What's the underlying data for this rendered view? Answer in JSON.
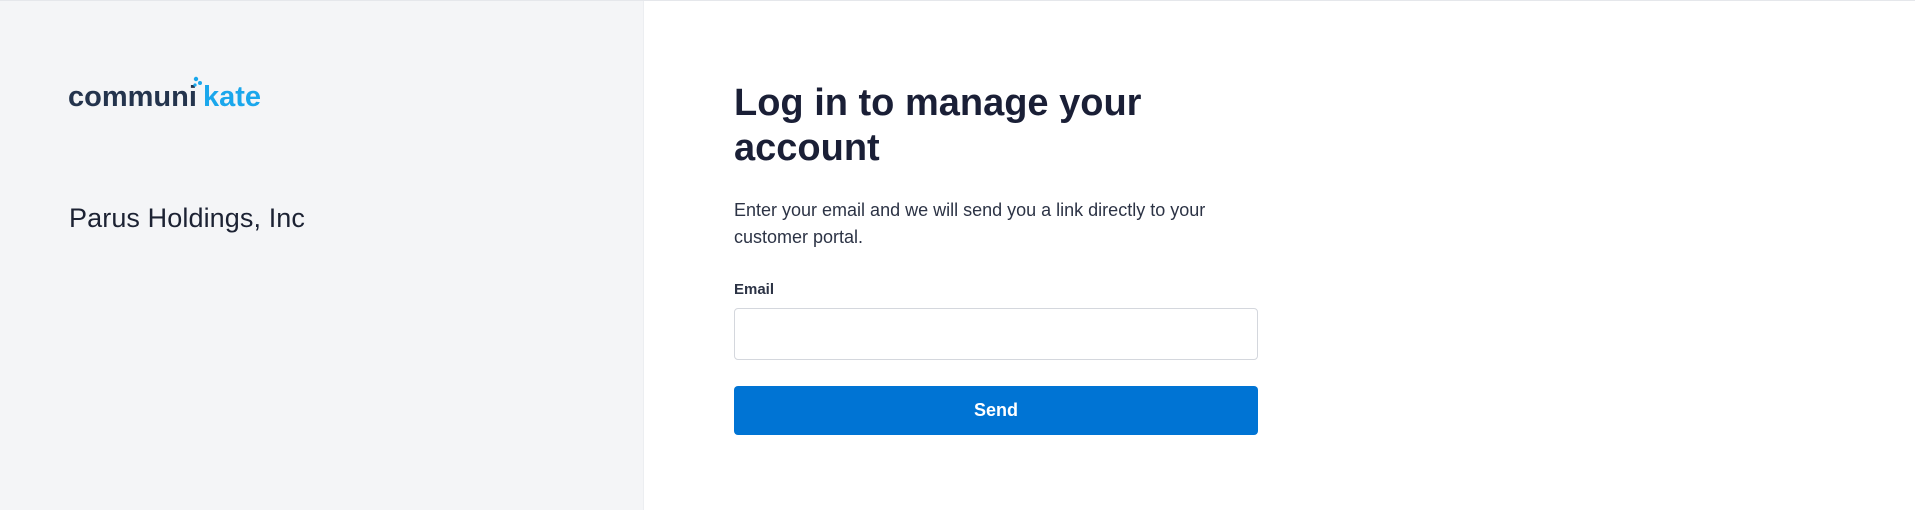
{
  "brand": {
    "logo_text_dark": "communi",
    "logo_text_accent": "kate",
    "dark_color": "#24344d",
    "accent_color": "#1aa7ec"
  },
  "sidebar": {
    "company_name": "Parus Holdings, Inc"
  },
  "login": {
    "title": "Log in to manage your account",
    "description": "Enter your email and we will send you a link directly to your customer portal.",
    "email_label": "Email",
    "email_value": "",
    "email_placeholder": "",
    "send_label": "Send",
    "button_color": "#0074d4"
  }
}
